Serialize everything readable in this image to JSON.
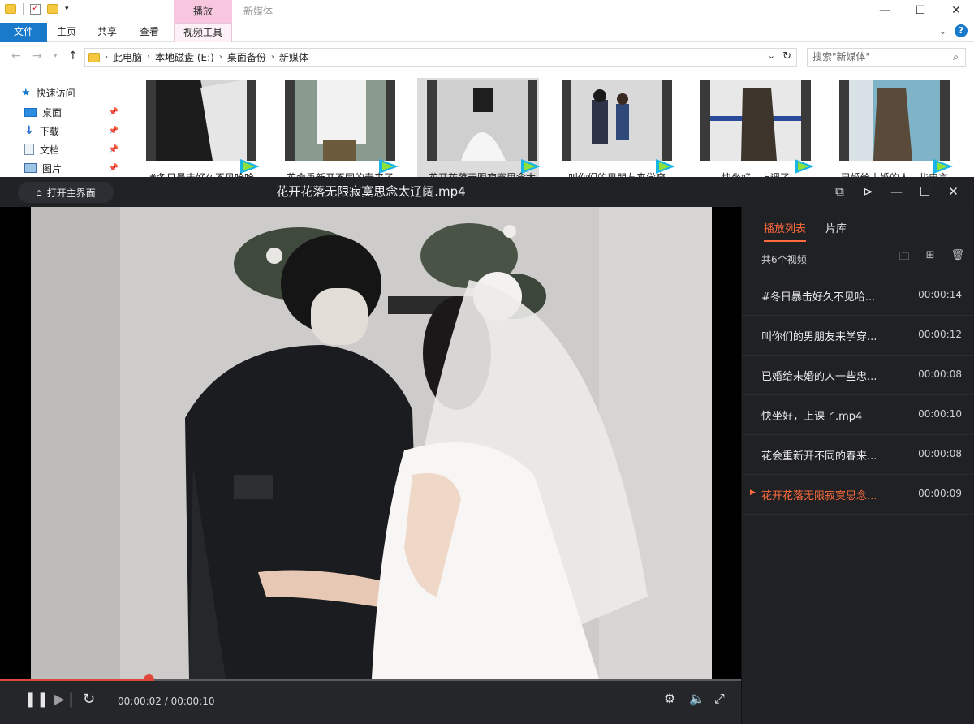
{
  "explorer": {
    "context_tab": "播放",
    "window_title": "新媒体",
    "ribbon_tabs": [
      "文件",
      "主页",
      "共享",
      "查看",
      "视频工具"
    ],
    "breadcrumb": [
      "此电脑",
      "本地磁盘 (E:)",
      "桌面备份",
      "新媒体"
    ],
    "search_placeholder": "搜索\"新媒体\"",
    "nav": {
      "quick_access": "快速访问",
      "items": [
        "桌面",
        "下载",
        "文档",
        "图片"
      ]
    },
    "files": [
      "#冬日暴击好久不见哈哈",
      "花会重新开不同的春来了",
      "花开花落无限寂寞思念太",
      "叫你们的男朋友来学穿",
      "快坐好，上课了",
      "已婚给未婚的人一些忠言"
    ]
  },
  "player": {
    "home_label": "打开主界面",
    "title": "花开花落无限寂寞思念太辽阔.mp4",
    "progress": 0.2,
    "time_current": "00:00:02",
    "time_total": "00:00:10",
    "time_display": "00:00:02 / 00:00:10",
    "sidebar": {
      "tabs": [
        "播放列表",
        "片库"
      ],
      "count": "共6个视频",
      "playlist": [
        {
          "name": "#冬日暴击好久不见哈...",
          "duration": "00:00:14"
        },
        {
          "name": "叫你们的男朋友来学穿...",
          "duration": "00:00:12"
        },
        {
          "name": "已婚给未婚的人一些忠...",
          "duration": "00:00:08"
        },
        {
          "name": "快坐好，上课了.mp4",
          "duration": "00:00:10"
        },
        {
          "name": "花会重新开不同的春来...",
          "duration": "00:00:08"
        },
        {
          "name": "花开花落无限寂寞思念...",
          "duration": "00:00:09"
        }
      ]
    }
  },
  "colors": {
    "accent": "#ff6b3d",
    "progress": "#e0473a",
    "ribbon_file": "#1979ca",
    "context_tab": "#f8c6de"
  }
}
